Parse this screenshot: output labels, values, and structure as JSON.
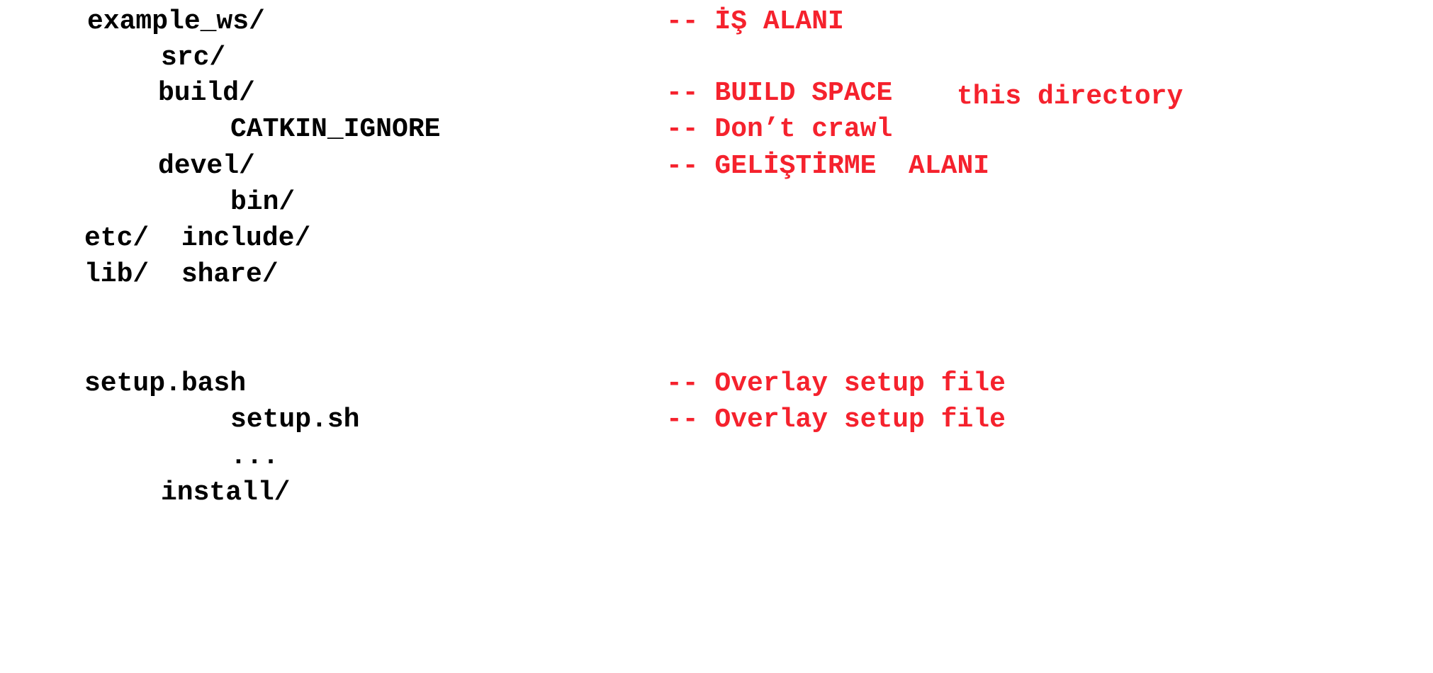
{
  "tree": {
    "workspace": "example_ws/",
    "src": "src/",
    "build": "build/",
    "catkin_ignore": "CATKIN_IGNORE",
    "devel": "devel/",
    "bin": "bin/",
    "etc_include": "etc/  include/",
    "lib_share": "lib/  share/",
    "setup_bash": "setup.bash",
    "setup_sh": "setup.sh",
    "ellipsis": "...",
    "install": "install/"
  },
  "notes": {
    "workspace": "-- İŞ ALANI",
    "build": "-- BUILD SPACE",
    "this_directory": "this directory",
    "catkin_ignore": "-- Don’t crawl",
    "devel": "-- GELİŞTİRME  ALANI",
    "setup_bash": "-- Overlay setup file",
    "setup_sh": "-- Overlay setup file"
  },
  "colors": {
    "tree_text": "#000000",
    "annotation_text": "#f5222d",
    "background": "#ffffff"
  }
}
